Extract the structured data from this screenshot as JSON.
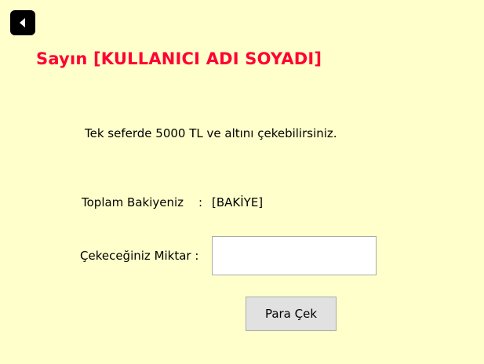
{
  "header": {
    "back_icon": "back-arrow-icon",
    "greeting": "Sayın [KULLANICI ADI SOYADI]"
  },
  "info": {
    "limit_text": "Tek seferde 5000 TL ve altını çekebilirsiniz."
  },
  "balance": {
    "label": "Toplam Bakiyeniz",
    "separator": ":",
    "value": "[BAKİYE]"
  },
  "amount": {
    "label": "Çekeceğiniz Miktar :",
    "value": ""
  },
  "actions": {
    "withdraw_label": "Para Çek"
  },
  "colors": {
    "background": "#ffffcc",
    "greeting": "#ff0033"
  }
}
